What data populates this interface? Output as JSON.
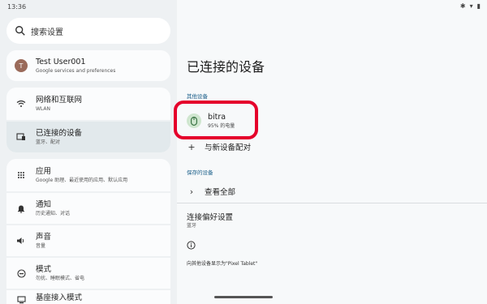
{
  "status": {
    "time": "13:36"
  },
  "search": {
    "label": "搜索设置"
  },
  "account": {
    "avatar": "T",
    "name": "Test User001",
    "sub": "Google services and preferences"
  },
  "network_card": [
    {
      "title": "网络和互联网",
      "sub": "WLAN",
      "icon": "wifi-icon"
    },
    {
      "title": "已连接的设备",
      "sub": "蓝牙、配对",
      "icon": "devices-icon"
    }
  ],
  "apps_card": [
    {
      "title": "应用",
      "sub": "Google 助理、最近使用的应用、默认应用",
      "icon": "apps-grid-icon"
    },
    {
      "title": "通知",
      "sub": "历史通知、对话",
      "icon": "bell-icon"
    },
    {
      "title": "声音",
      "sub": "音量",
      "icon": "volume-icon"
    },
    {
      "title": "模式",
      "sub": "勿扰、睡眠模式、省电",
      "icon": "modes-icon"
    },
    {
      "title": "基座接入模式",
      "sub": "",
      "icon": "dock-icon"
    }
  ],
  "main": {
    "title": "已连接的设备",
    "media_label": "其他设备",
    "device": {
      "name": "bitra",
      "sub": "95% 的电量"
    },
    "pair_new": "与新设备配对",
    "saved_label": "保存的设备",
    "see_all": "查看全部",
    "pref_title": "连接偏好设置",
    "pref_sub": "蓝牙",
    "footer": "向其他设备显示为\"Pixel Tablet\""
  }
}
